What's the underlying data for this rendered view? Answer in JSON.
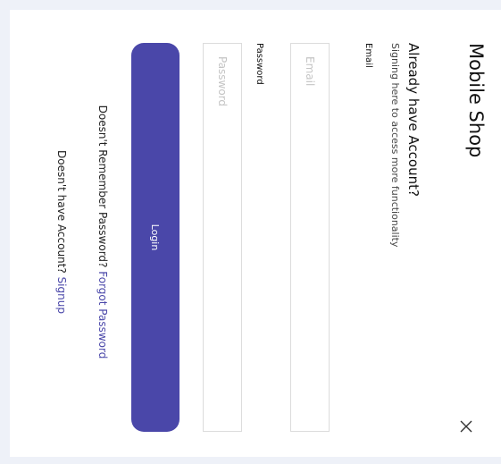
{
  "app": {
    "title": "Mobile Shop"
  },
  "modal": {
    "close_icon": "close-icon",
    "heading": "Already have Account?",
    "subheading": "Signing here to access more functionality"
  },
  "form": {
    "email_label": "Email",
    "email_placeholder": "Email",
    "email_value": "",
    "password_label": "Password",
    "password_placeholder": "Password",
    "password_value": "",
    "login_label": "Login"
  },
  "footer": {
    "forgot_prompt": "Doesn't Remember Password?",
    "forgot_link": "Forgot Password",
    "signup_prompt": "Doesn't have Account?",
    "signup_link": "Signup"
  },
  "colors": {
    "accent": "#4a47a9",
    "background": "#eef1f8",
    "surface": "#ffffff",
    "input_border": "#dcdcdc",
    "placeholder": "#c4c4c4"
  }
}
